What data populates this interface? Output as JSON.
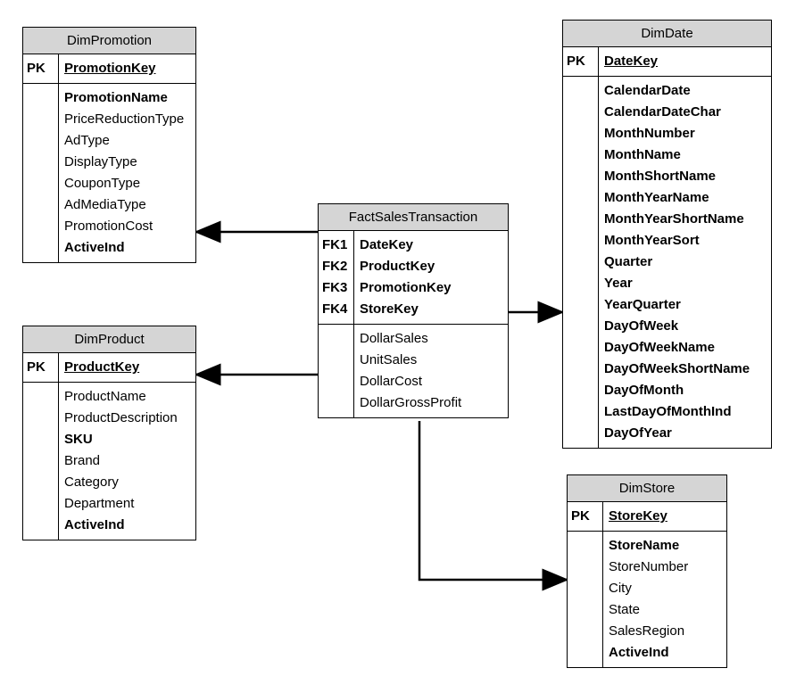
{
  "entities": {
    "dimPromotion": {
      "title": "DimPromotion",
      "pkLabel": "PK",
      "pkField": "PromotionKey",
      "fields": [
        {
          "name": "PromotionName",
          "bold": true
        },
        {
          "name": "PriceReductionType",
          "bold": false
        },
        {
          "name": "AdType",
          "bold": false
        },
        {
          "name": "DisplayType",
          "bold": false
        },
        {
          "name": "CouponType",
          "bold": false
        },
        {
          "name": "AdMediaType",
          "bold": false
        },
        {
          "name": "PromotionCost",
          "bold": false
        },
        {
          "name": "ActiveInd",
          "bold": true
        }
      ]
    },
    "dimProduct": {
      "title": "DimProduct",
      "pkLabel": "PK",
      "pkField": "ProductKey",
      "fields": [
        {
          "name": "ProductName",
          "bold": false
        },
        {
          "name": "ProductDescription",
          "bold": false
        },
        {
          "name": "SKU",
          "bold": true
        },
        {
          "name": "Brand",
          "bold": false
        },
        {
          "name": "Category",
          "bold": false
        },
        {
          "name": "Department",
          "bold": false
        },
        {
          "name": "ActiveInd",
          "bold": true
        }
      ]
    },
    "factSalesTransaction": {
      "title": "FactSalesTransaction",
      "fkLabels": [
        "FK1",
        "FK2",
        "FK3",
        "FK4"
      ],
      "fkFields": [
        "DateKey",
        "ProductKey",
        "PromotionKey",
        "StoreKey"
      ],
      "fields": [
        {
          "name": "DollarSales",
          "bold": false
        },
        {
          "name": "UnitSales",
          "bold": false
        },
        {
          "name": "DollarCost",
          "bold": false
        },
        {
          "name": "DollarGrossProfit",
          "bold": false
        }
      ]
    },
    "dimDate": {
      "title": "DimDate",
      "pkLabel": "PK",
      "pkField": "DateKey",
      "fields": [
        {
          "name": "CalendarDate",
          "bold": true
        },
        {
          "name": "CalendarDateChar",
          "bold": true
        },
        {
          "name": "MonthNumber",
          "bold": true
        },
        {
          "name": "MonthName",
          "bold": true
        },
        {
          "name": "MonthShortName",
          "bold": true
        },
        {
          "name": "MonthYearName",
          "bold": true
        },
        {
          "name": "MonthYearShortName",
          "bold": true
        },
        {
          "name": "MonthYearSort",
          "bold": true
        },
        {
          "name": "Quarter",
          "bold": true
        },
        {
          "name": "Year",
          "bold": true
        },
        {
          "name": "YearQuarter",
          "bold": true
        },
        {
          "name": "DayOfWeek",
          "bold": true
        },
        {
          "name": "DayOfWeekName",
          "bold": true
        },
        {
          "name": "DayOfWeekShortName",
          "bold": true
        },
        {
          "name": "DayOfMonth",
          "bold": true
        },
        {
          "name": "LastDayOfMonthInd",
          "bold": true
        },
        {
          "name": "DayOfYear",
          "bold": true
        }
      ]
    },
    "dimStore": {
      "title": "DimStore",
      "pkLabel": "PK",
      "pkField": "StoreKey",
      "fields": [
        {
          "name": "StoreName",
          "bold": true
        },
        {
          "name": "StoreNumber",
          "bold": false
        },
        {
          "name": "City",
          "bold": false
        },
        {
          "name": "State",
          "bold": false
        },
        {
          "name": "SalesRegion",
          "bold": false
        },
        {
          "name": "ActiveInd",
          "bold": true
        }
      ]
    }
  }
}
